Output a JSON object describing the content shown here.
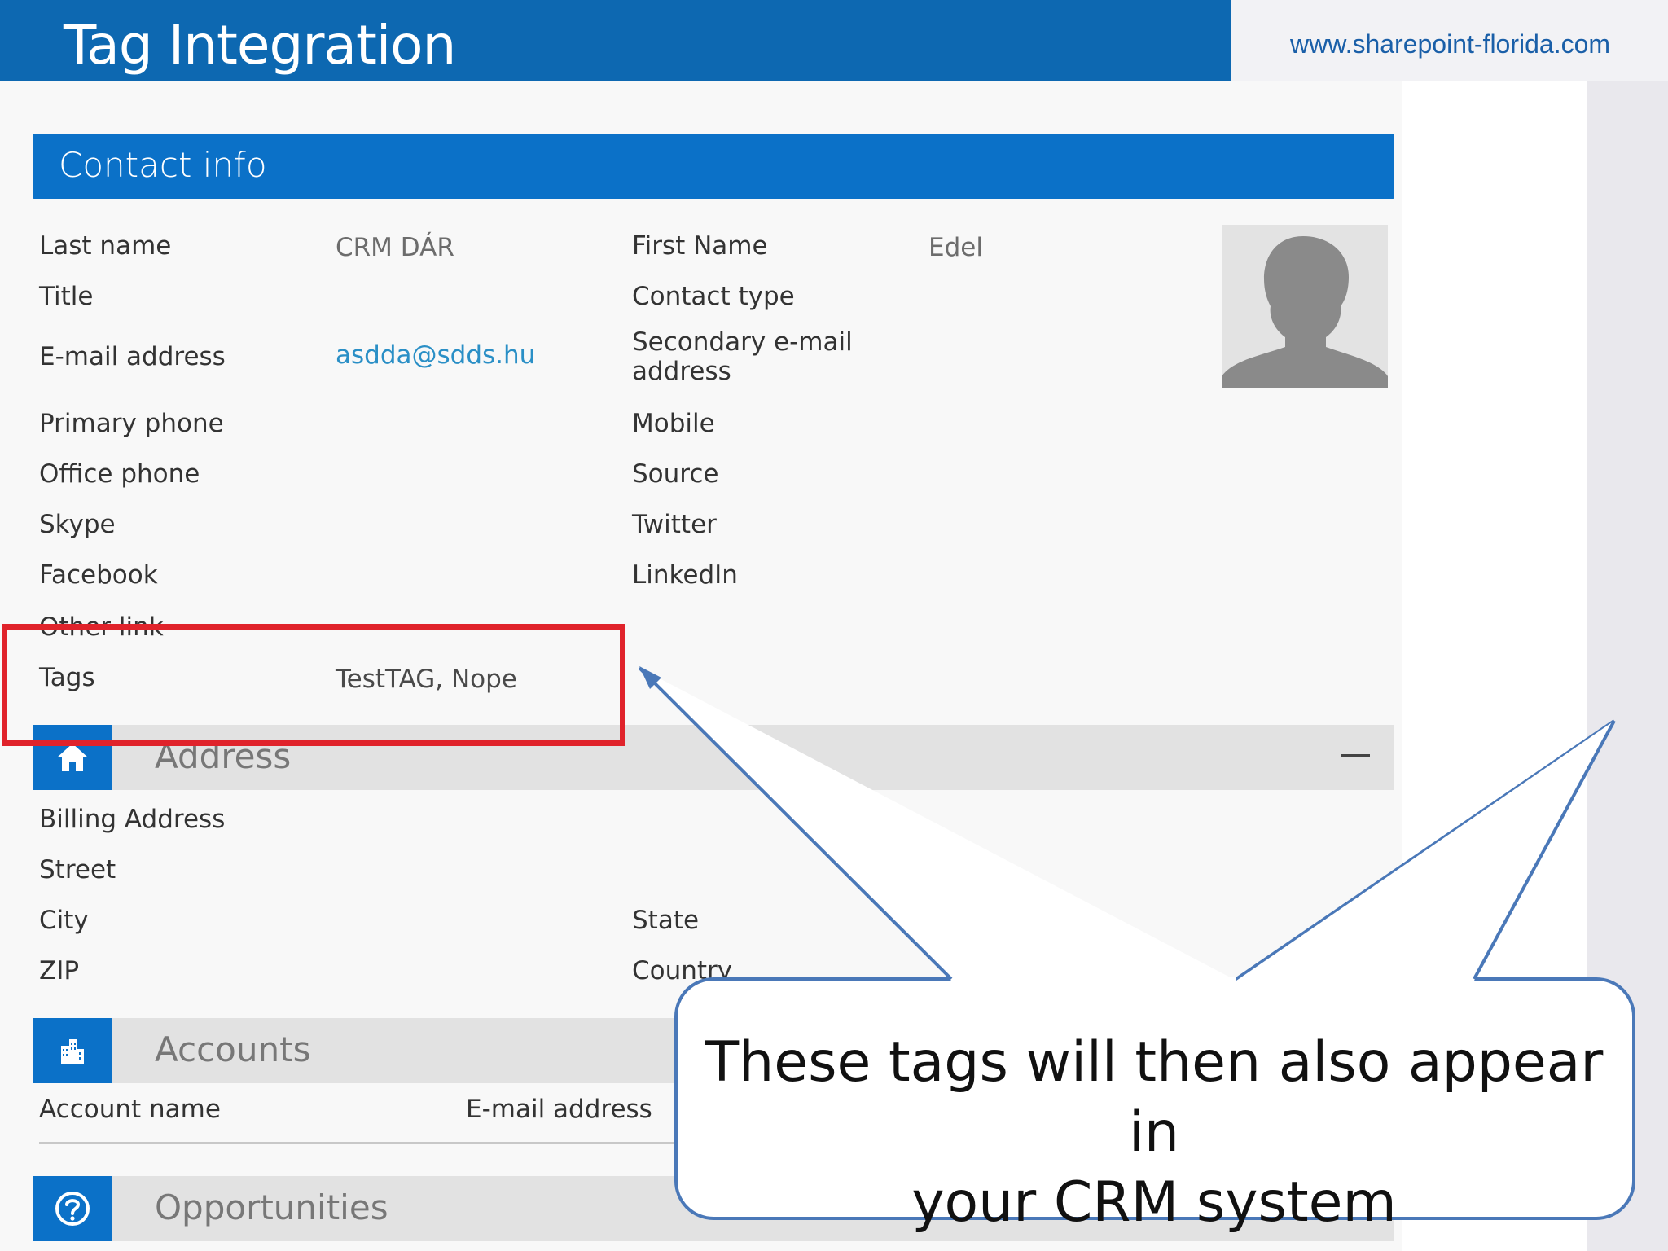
{
  "header": {
    "title": "Tag Integration",
    "website": "www.sharepoint-florida.com"
  },
  "contact_section": {
    "title": "Contact info",
    "fields_left": [
      {
        "label": "Last name",
        "value": "CRM DÁR"
      },
      {
        "label": "Title",
        "value": ""
      },
      {
        "label": "E-mail address",
        "value": "asdda@sdds.hu"
      },
      {
        "label": "Primary phone",
        "value": ""
      },
      {
        "label": "Office phone",
        "value": ""
      },
      {
        "label": "Skype",
        "value": ""
      },
      {
        "label": "Facebook",
        "value": ""
      },
      {
        "label": "Other link",
        "value": ""
      },
      {
        "label": "Tags",
        "value": "TestTAG, Nope"
      }
    ],
    "fields_right": [
      {
        "label": "First Name",
        "value": "Edel"
      },
      {
        "label": "Contact type",
        "value": ""
      },
      {
        "label": "Secondary e-mail",
        "label2": "address",
        "value": ""
      },
      {
        "label": "Mobile",
        "value": ""
      },
      {
        "label": "Source",
        "value": ""
      },
      {
        "label": "Twitter",
        "value": ""
      },
      {
        "label": "LinkedIn",
        "value": ""
      }
    ]
  },
  "address_section": {
    "title": "Address",
    "icon": "home-icon",
    "fields": [
      {
        "label": "Billing Address"
      },
      {
        "label": "Street"
      },
      {
        "label": "City"
      },
      {
        "label": "State"
      },
      {
        "label": "ZIP"
      },
      {
        "label": "Country"
      }
    ]
  },
  "accounts_section": {
    "title": "Accounts",
    "icon": "building-icon",
    "columns": [
      "Account name",
      "E-mail address"
    ]
  },
  "opportunities_section": {
    "title": "Opportunities",
    "icon": "question-circle-icon"
  },
  "callout": {
    "line1": "These tags will then also appear in",
    "line2": "your CRM system"
  },
  "colors": {
    "banner": "#0d68b1",
    "section_header": "#0b71c8",
    "highlight": "#e0232b",
    "callout_stroke": "#4a78b8"
  }
}
